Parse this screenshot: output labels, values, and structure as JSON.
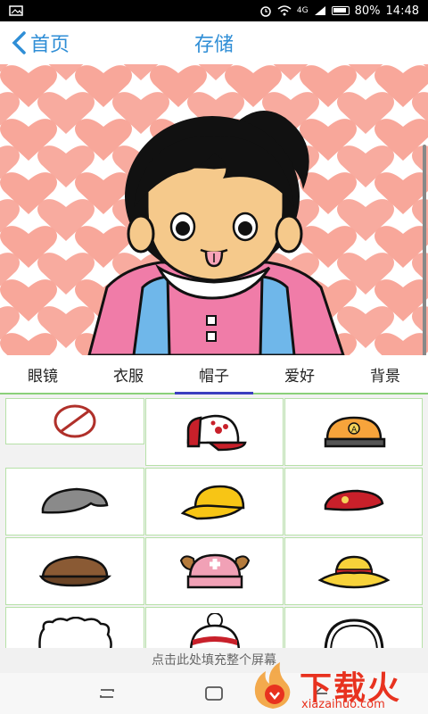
{
  "status_bar": {
    "network": "4G",
    "battery": "80%",
    "time": "14:48",
    "icons": [
      "image-icon",
      "alarm-icon",
      "wifi-icon",
      "signal-icon",
      "battery-icon"
    ]
  },
  "nav": {
    "back_label": "首页",
    "save_label": "存储",
    "accent_color": "#2f8ed6"
  },
  "tabs": [
    {
      "label": "眼镜",
      "active": false
    },
    {
      "label": "衣服",
      "active": false
    },
    {
      "label": "帽子",
      "active": true
    },
    {
      "label": "爱好",
      "active": false
    },
    {
      "label": "背景",
      "active": false
    }
  ],
  "hat_items": [
    "none-icon",
    "baseball-cap-icon",
    "orange-cap-icon",
    "gray-flat-cap-icon",
    "yellow-cap-icon",
    "red-beret-icon",
    "brown-newsboy-cap-icon",
    "pink-chopper-hat-icon",
    "straw-hat-icon",
    "white-fluffy-hat-icon",
    "beanie-icon",
    "headphones-icon"
  ],
  "hint": {
    "text": "点击此处填充整个屏幕"
  },
  "system_nav": {
    "icons": [
      "recent-apps-icon",
      "home-icon",
      "back-icon"
    ]
  },
  "watermark": {
    "brand": "下载火",
    "url": "xiazaihuo.com"
  }
}
